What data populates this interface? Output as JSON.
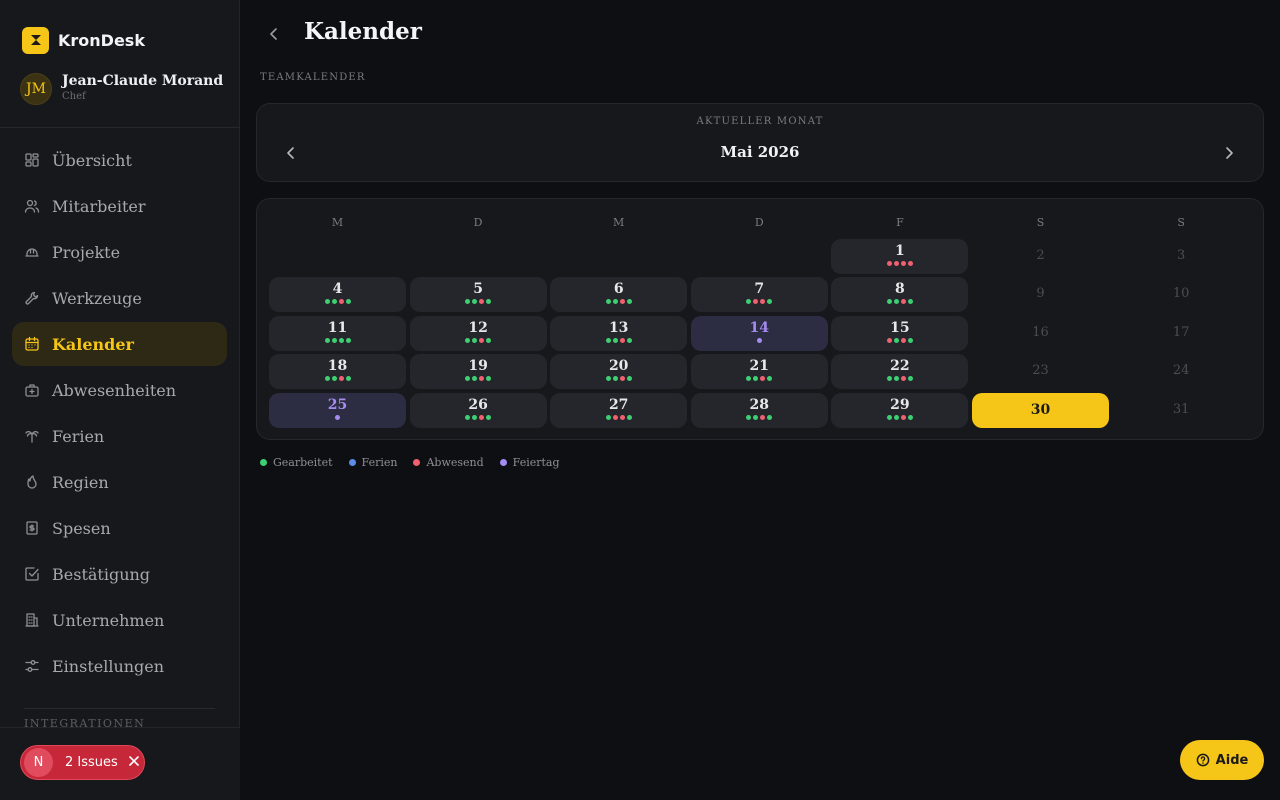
{
  "app": {
    "name": "KronDesk"
  },
  "user": {
    "initials": "JM",
    "name": "Jean-Claude Morand",
    "role": "Chef"
  },
  "nav": [
    {
      "label": "Übersicht",
      "icon": "dashboard-icon"
    },
    {
      "label": "Mitarbeiter",
      "icon": "users-icon"
    },
    {
      "label": "Projekte",
      "icon": "hard-hat-icon"
    },
    {
      "label": "Werkzeuge",
      "icon": "wrench-icon"
    },
    {
      "label": "Kalender",
      "icon": "calendar-icon",
      "active": true
    },
    {
      "label": "Abwesenheiten",
      "icon": "medical-bag-icon"
    },
    {
      "label": "Ferien",
      "icon": "palm-tree-icon"
    },
    {
      "label": "Regien",
      "icon": "flame-icon"
    },
    {
      "label": "Spesen",
      "icon": "receipt-icon"
    },
    {
      "label": "Bestätigung",
      "icon": "check-square-icon"
    },
    {
      "label": "Unternehmen",
      "icon": "building-icon"
    },
    {
      "label": "Einstellungen",
      "icon": "sliders-icon"
    }
  ],
  "integrations_label": "INTEGRATIONEN",
  "issues": {
    "badge": "N",
    "label": "2 Issues"
  },
  "page": {
    "title": "Kalender",
    "section_label": "TEAMKALENDER"
  },
  "month": {
    "caption": "AKTUELLER MONAT",
    "name": "Mai 2026"
  },
  "weekdays": [
    "M",
    "D",
    "M",
    "D",
    "F",
    "S",
    "S"
  ],
  "colors": {
    "accent": "#f5c518",
    "worked": "#3ecf73",
    "vacation": "#5b8de6",
    "absent": "#f06070",
    "holiday": "#a58cf0"
  },
  "days": [
    {
      "num": "1",
      "col": 4,
      "row": 0,
      "type": "work",
      "dots": [
        "absent",
        "absent",
        "absent",
        "absent"
      ]
    },
    {
      "num": "2",
      "col": 5,
      "row": 0,
      "type": "weekend"
    },
    {
      "num": "3",
      "col": 6,
      "row": 0,
      "type": "weekend"
    },
    {
      "num": "4",
      "col": 0,
      "row": 1,
      "type": "work",
      "dots": [
        "worked",
        "worked",
        "absent",
        "worked"
      ]
    },
    {
      "num": "5",
      "col": 1,
      "row": 1,
      "type": "work",
      "dots": [
        "worked",
        "worked",
        "absent",
        "worked"
      ]
    },
    {
      "num": "6",
      "col": 2,
      "row": 1,
      "type": "work",
      "dots": [
        "worked",
        "worked",
        "absent",
        "worked"
      ]
    },
    {
      "num": "7",
      "col": 3,
      "row": 1,
      "type": "work",
      "dots": [
        "worked",
        "absent",
        "absent",
        "worked"
      ]
    },
    {
      "num": "8",
      "col": 4,
      "row": 1,
      "type": "work",
      "dots": [
        "worked",
        "worked",
        "absent",
        "worked"
      ]
    },
    {
      "num": "9",
      "col": 5,
      "row": 1,
      "type": "weekend"
    },
    {
      "num": "10",
      "col": 6,
      "row": 1,
      "type": "weekend"
    },
    {
      "num": "11",
      "col": 0,
      "row": 2,
      "type": "work",
      "dots": [
        "worked",
        "worked",
        "worked",
        "worked"
      ]
    },
    {
      "num": "12",
      "col": 1,
      "row": 2,
      "type": "work",
      "dots": [
        "worked",
        "worked",
        "absent",
        "worked"
      ]
    },
    {
      "num": "13",
      "col": 2,
      "row": 2,
      "type": "work",
      "dots": [
        "worked",
        "worked",
        "absent",
        "worked"
      ]
    },
    {
      "num": "14",
      "col": 3,
      "row": 2,
      "type": "holiday",
      "dots": [
        "holiday"
      ]
    },
    {
      "num": "15",
      "col": 4,
      "row": 2,
      "type": "work",
      "dots": [
        "absent",
        "worked",
        "absent",
        "worked"
      ]
    },
    {
      "num": "16",
      "col": 5,
      "row": 2,
      "type": "weekend"
    },
    {
      "num": "17",
      "col": 6,
      "row": 2,
      "type": "weekend"
    },
    {
      "num": "18",
      "col": 0,
      "row": 3,
      "type": "work",
      "dots": [
        "worked",
        "worked",
        "absent",
        "worked"
      ]
    },
    {
      "num": "19",
      "col": 1,
      "row": 3,
      "type": "work",
      "dots": [
        "worked",
        "worked",
        "absent",
        "worked"
      ]
    },
    {
      "num": "20",
      "col": 2,
      "row": 3,
      "type": "work",
      "dots": [
        "worked",
        "worked",
        "absent",
        "worked"
      ]
    },
    {
      "num": "21",
      "col": 3,
      "row": 3,
      "type": "work",
      "dots": [
        "worked",
        "worked",
        "absent",
        "worked"
      ]
    },
    {
      "num": "22",
      "col": 4,
      "row": 3,
      "type": "work",
      "dots": [
        "worked",
        "worked",
        "absent",
        "worked"
      ]
    },
    {
      "num": "23",
      "col": 5,
      "row": 3,
      "type": "weekend"
    },
    {
      "num": "24",
      "col": 6,
      "row": 3,
      "type": "weekend"
    },
    {
      "num": "25",
      "col": 0,
      "row": 4,
      "type": "holiday",
      "dots": [
        "holiday"
      ]
    },
    {
      "num": "26",
      "col": 1,
      "row": 4,
      "type": "work",
      "dots": [
        "worked",
        "worked",
        "absent",
        "worked"
      ]
    },
    {
      "num": "27",
      "col": 2,
      "row": 4,
      "type": "work",
      "dots": [
        "worked",
        "absent",
        "absent",
        "worked"
      ]
    },
    {
      "num": "28",
      "col": 3,
      "row": 4,
      "type": "work",
      "dots": [
        "worked",
        "worked",
        "absent",
        "worked"
      ]
    },
    {
      "num": "29",
      "col": 4,
      "row": 4,
      "type": "work",
      "dots": [
        "worked",
        "worked",
        "absent",
        "worked"
      ]
    },
    {
      "num": "30",
      "col": 5,
      "row": 4,
      "type": "today"
    },
    {
      "num": "31",
      "col": 6,
      "row": 4,
      "type": "weekend"
    }
  ],
  "legend": [
    {
      "label": "Gearbeitet",
      "color_key": "worked"
    },
    {
      "label": "Ferien",
      "color_key": "vacation"
    },
    {
      "label": "Abwesend",
      "color_key": "absent"
    },
    {
      "label": "Feiertag",
      "color_key": "holiday"
    }
  ],
  "help": {
    "label": "Aide"
  }
}
